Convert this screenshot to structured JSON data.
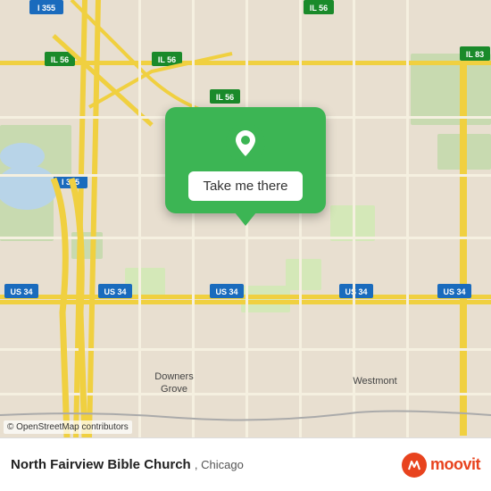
{
  "map": {
    "attribution": "© OpenStreetMap contributors",
    "bg_color": "#e8dfd0"
  },
  "popup": {
    "button_label": "Take me there",
    "bg_color": "#3cb554"
  },
  "bottom_bar": {
    "place_name": "North Fairview Bible Church",
    "place_city": "Chicago",
    "place_full": "North Fairview Bible Church, Chicago",
    "moovit_label": "moovit"
  },
  "roads": {
    "i355_label": "I 355",
    "il56_label": "IL 56",
    "il83_label": "IL 83",
    "us34_label": "US 34",
    "downers_grove": "Downers Grove",
    "westmont": "Westmont"
  }
}
